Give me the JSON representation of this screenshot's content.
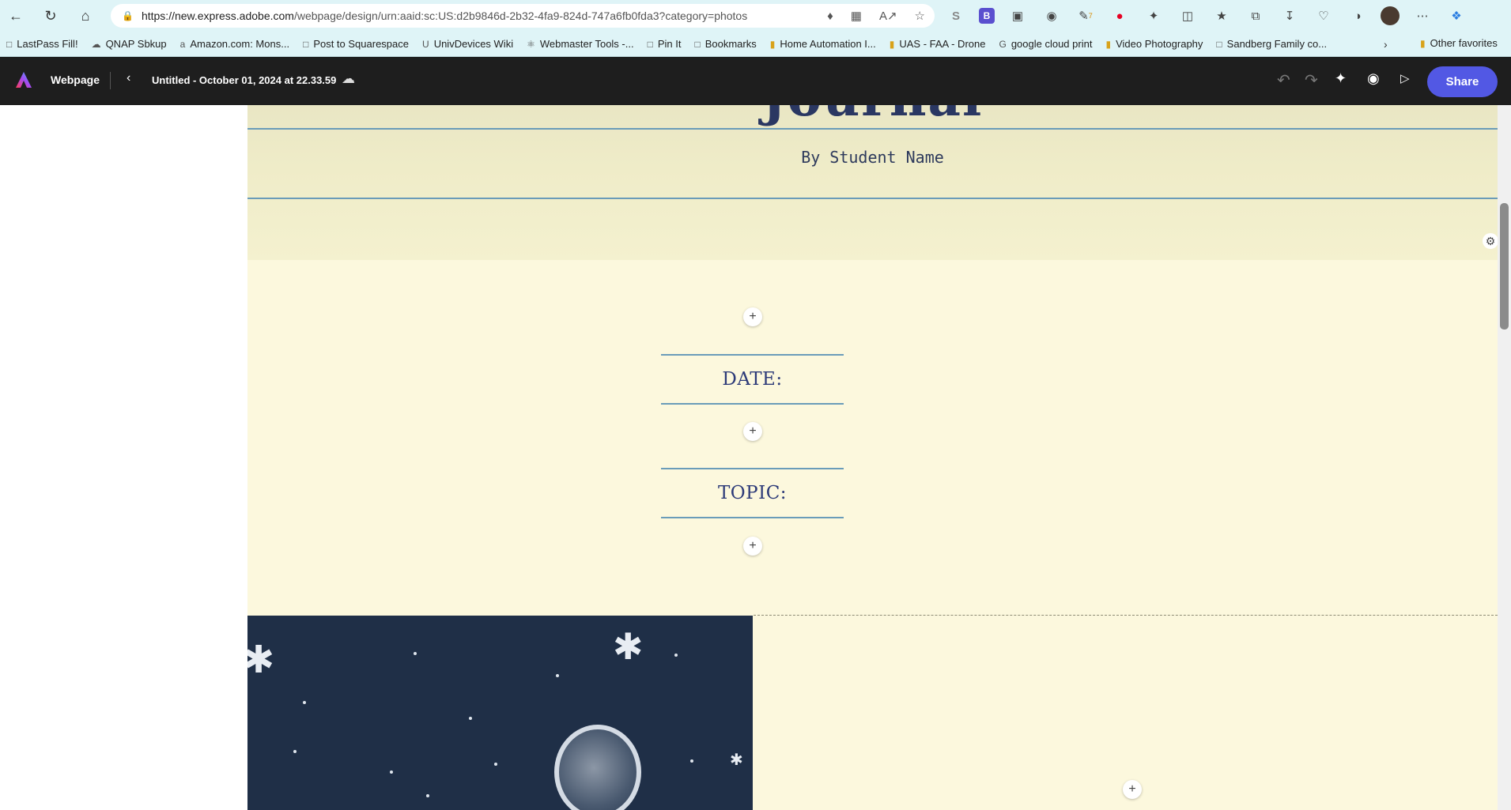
{
  "browser": {
    "url_host": "https://new.express.adobe.com",
    "url_path": "/webpage/design/urn:aaid:sc:US:d2b9846d-2b32-4fa9-824d-747a6fb0fda3?category=photos",
    "ext_b_badge": "B",
    "ext_draw_badge": "7",
    "ext_s_label": "S"
  },
  "bookmarks": [
    {
      "label": "LastPass Fill!"
    },
    {
      "label": "QNAP Sbkup"
    },
    {
      "label": "Amazon.com: Mons..."
    },
    {
      "label": "Post to Squarespace"
    },
    {
      "label": "UnivDevices Wiki"
    },
    {
      "label": "Webmaster Tools -..."
    },
    {
      "label": "Pin It"
    },
    {
      "label": "Bookmarks"
    },
    {
      "label": "Home Automation I..."
    },
    {
      "label": "UAS - FAA - Drone"
    },
    {
      "label": "google cloud print"
    },
    {
      "label": "Video Photography"
    },
    {
      "label": "Sandberg Family co..."
    }
  ],
  "bookmarks_other": "Other favorites",
  "app": {
    "name": "Webpage",
    "doc_title": "Untitled - October 01, 2024 at 22.33.59",
    "share_label": "Share",
    "accent_color": "#5258e4"
  },
  "canvas": {
    "hero_title": "Journal",
    "byline": "By Student Name",
    "date_label": "DATE:",
    "topic_label": "TOPIC:",
    "add_symbol": "+"
  }
}
